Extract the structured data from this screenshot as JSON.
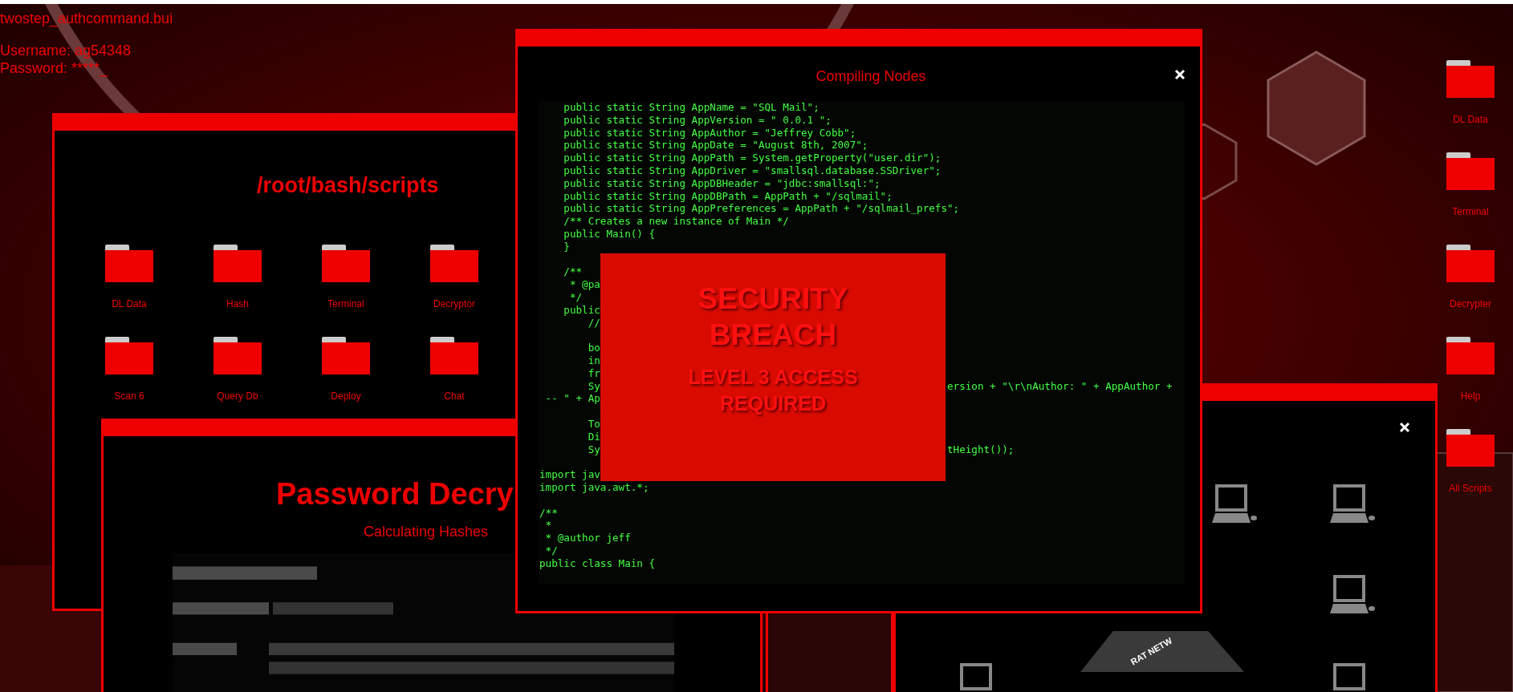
{
  "file_title": "twostep_authcommand.bui",
  "login": {
    "username": "Username: ag54348",
    "password": "Password: *****_"
  },
  "scripts_window": {
    "title": "/root/bash/scripts",
    "folders": [
      {
        "label": "DL Data"
      },
      {
        "label": "Hash"
      },
      {
        "label": "Terminal"
      },
      {
        "label": "Decryptor"
      },
      {
        "label": "Scan 6"
      },
      {
        "label": "Query Db"
      },
      {
        "label": "Deploy"
      },
      {
        "label": "Chat"
      }
    ]
  },
  "decryptor_window": {
    "title": "Password Decry",
    "subtitle": "Calculating Hashes"
  },
  "network_window": {
    "logo_text": "RAT NETW"
  },
  "code_window": {
    "title": "Compiling Nodes",
    "lines": [
      {
        "kind": "code",
        "text": "    public static String AppName = \"SQL Mail\";"
      },
      {
        "kind": "code",
        "text": "    public static String AppVersion = \" 0.0.1 \";"
      },
      {
        "kind": "code",
        "text": "    public static String AppAuthor = \"Jeffrey Cobb\";"
      },
      {
        "kind": "code",
        "text": "    public static String AppDate = \"August 8th, 2007\";"
      },
      {
        "kind": "code",
        "text": "    public static String AppPath = System.getProperty(\"user.dir\");"
      },
      {
        "kind": "code",
        "text": "    public static String AppDriver = \"smallsql.database.SSDriver\";"
      },
      {
        "kind": "code",
        "text": "    public static String AppDBHeader = \"jdbc:smallsql:\";"
      },
      {
        "kind": "code",
        "text": "    public static String AppDBPath = AppPath + \"/sqlmail\";"
      },
      {
        "kind": "code",
        "text": "    public static String AppPreferences = AppPath + \"/sqlmail_prefs\";"
      },
      {
        "kind": "code",
        "text": "    /** Creates a new instance of Main */"
      },
      {
        "kind": "code",
        "text": "    public Main() {"
      },
      {
        "kind": "code",
        "text": "    }"
      },
      {
        "kind": "blank"
      },
      {
        "kind": "split",
        "left": "    /**"
      },
      {
        "kind": "split",
        "left": "     * @pa"
      },
      {
        "kind": "split",
        "left": "     */"
      },
      {
        "kind": "split",
        "left": "    public"
      },
      {
        "kind": "split",
        "left": "        //"
      },
      {
        "kind": "blank"
      },
      {
        "kind": "split",
        "left": "        bo"
      },
      {
        "kind": "split",
        "left": "        in"
      },
      {
        "kind": "split",
        "left": "        fr"
      },
      {
        "kind": "split",
        "left": "        Sy",
        "right": "ersion + \"\\r\\nAuthor: \" + AppAuthor +"
      },
      {
        "kind": "split",
        "left": " -- \" + Ap"
      },
      {
        "kind": "blank"
      },
      {
        "kind": "split",
        "left": "        To"
      },
      {
        "kind": "split",
        "left": "        Di"
      },
      {
        "kind": "split",
        "left": "        Sy",
        "right": "tHeight());"
      },
      {
        "kind": "blank"
      },
      {
        "kind": "split",
        "left": "import jav"
      },
      {
        "kind": "code",
        "text": "import java.awt.*;"
      },
      {
        "kind": "blank"
      },
      {
        "kind": "code",
        "text": "/**"
      },
      {
        "kind": "code",
        "text": " *"
      },
      {
        "kind": "code",
        "text": " * @author jeff"
      },
      {
        "kind": "code",
        "text": " */"
      },
      {
        "kind": "code",
        "text": "public class Main {"
      }
    ]
  },
  "alert": {
    "title": "SECURITY BREACH",
    "message": "LEVEL 3 ACCESS REQUIRED"
  },
  "desktop_icons": [
    {
      "label": "DL Data"
    },
    {
      "label": "Terminal"
    },
    {
      "label": "Decrypter"
    },
    {
      "label": "Help"
    },
    {
      "label": "All Scripts"
    }
  ]
}
